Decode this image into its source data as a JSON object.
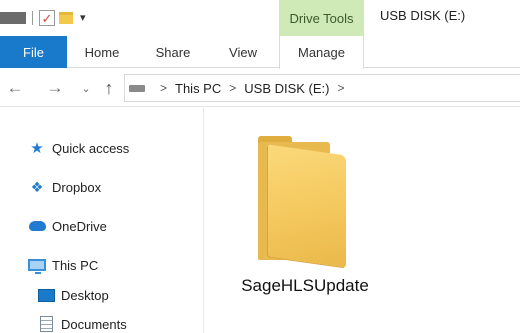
{
  "titlebar": {
    "contextual_tab": "Drive Tools",
    "window_title": "USB DISK (E:)",
    "quick_access_toolbar": {
      "check_glyph": "✓",
      "dropdown_glyph": "▾"
    }
  },
  "ribbon": {
    "tabs": [
      {
        "label": "File"
      },
      {
        "label": "Home"
      },
      {
        "label": "Share"
      },
      {
        "label": "View"
      },
      {
        "label": "Manage"
      }
    ]
  },
  "address": {
    "back_glyph": "←",
    "forward_glyph": "→",
    "recent_glyph": "⌄",
    "up_glyph": "↑",
    "separator": ">",
    "crumbs": [
      "This PC",
      "USB DISK (E:)"
    ]
  },
  "nav_pane": {
    "items": [
      {
        "label": "Quick access",
        "icon": "star-icon"
      },
      {
        "label": "Dropbox",
        "icon": "dropbox-icon"
      },
      {
        "label": "OneDrive",
        "icon": "cloud-icon"
      },
      {
        "label": "This PC",
        "icon": "monitor-icon"
      },
      {
        "label": "Desktop",
        "icon": "desktop-icon"
      },
      {
        "label": "Documents",
        "icon": "documents-icon"
      }
    ]
  },
  "content": {
    "items": [
      {
        "name": "SageHLSUpdate",
        "icon": "folder-icon"
      }
    ]
  },
  "colors": {
    "file_tab": "#1979ca",
    "contextual_tab": "#cfe9b7",
    "accent_icon": "#1f7ad1",
    "folder": "#f4c85d"
  }
}
